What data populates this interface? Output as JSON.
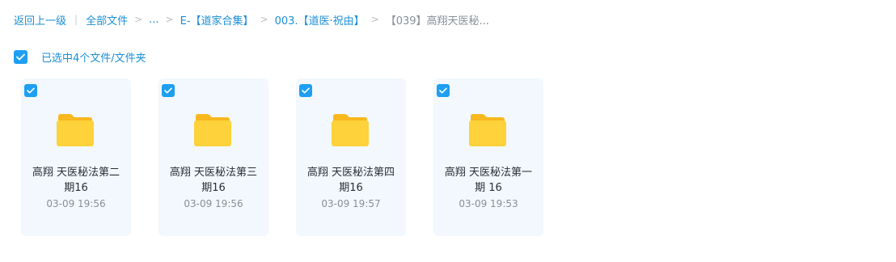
{
  "breadcrumb": {
    "back": "返回上一级",
    "all_files": "全部文件",
    "ellipsis": "...",
    "level1": "E-【道家合集】",
    "level2": "003.【道医·祝由】",
    "current": "【039】高翔天医秘..."
  },
  "selection": {
    "label": "已选中4个文件/文件夹",
    "checked": true
  },
  "files": [
    {
      "name_line1": "高翔 天医秘法第二",
      "name_line2": "期16",
      "date": "03-09 19:56",
      "checked": true
    },
    {
      "name_line1": "高翔 天医秘法第三",
      "name_line2": "期16",
      "date": "03-09 19:56",
      "checked": true
    },
    {
      "name_line1": "高翔 天医秘法第四",
      "name_line2": "期16",
      "date": "03-09 19:57",
      "checked": true
    },
    {
      "name_line1": "高翔 天医秘法第一",
      "name_line2": "期 16",
      "date": "03-09 19:53",
      "checked": true
    }
  ],
  "colors": {
    "accent": "#1e9ff2",
    "link": "#1b8fd6",
    "card_bg": "#f2f8fd",
    "folder": "#fbc02d"
  },
  "icons": {
    "checkbox": "check-icon",
    "folder": "folder-icon"
  }
}
